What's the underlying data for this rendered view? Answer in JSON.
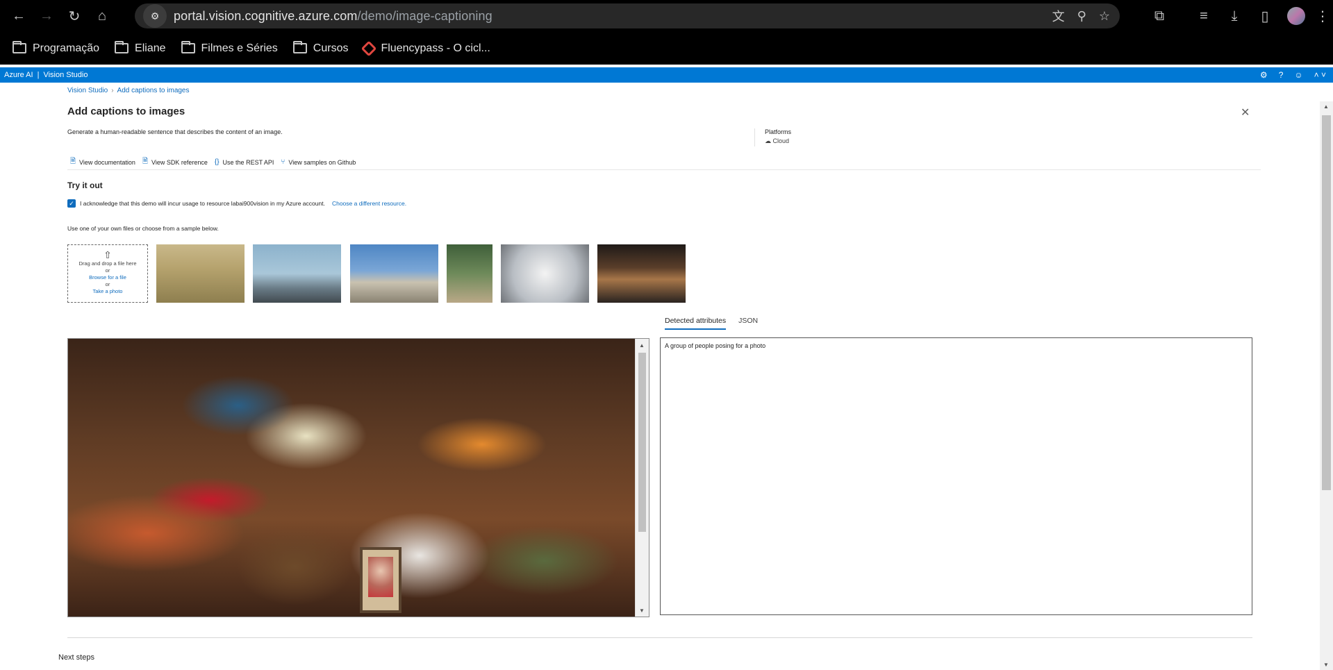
{
  "browser": {
    "url_host": "portal.vision.cognitive.azure.com",
    "url_path": "/demo/image-captioning",
    "bookmarks": [
      {
        "label": "Programação",
        "icon": "folder-icon"
      },
      {
        "label": "Eliane",
        "icon": "folder-icon"
      },
      {
        "label": "Filmes e Séries",
        "icon": "folder-icon"
      },
      {
        "label": "Cursos",
        "icon": "folder-icon"
      },
      {
        "label": "Fluencypass - O cicl...",
        "icon": "fluencypass-icon"
      }
    ]
  },
  "azure_header": {
    "brand": "Azure AI",
    "separator": "|",
    "product": "Vision Studio"
  },
  "breadcrumb": {
    "home": "Vision Studio",
    "current": "Add captions to images"
  },
  "page": {
    "title": "Add captions to images",
    "description": "Generate a human-readable sentence that describes the content of an image.",
    "platforms_label": "Platforms",
    "platforms_value": "Cloud",
    "links": [
      {
        "label": "View documentation",
        "icon": "document-icon"
      },
      {
        "label": "View SDK reference",
        "icon": "document-icon"
      },
      {
        "label": "Use the REST API",
        "icon": "braces-icon"
      },
      {
        "label": "View samples on Github",
        "icon": "branch-icon"
      }
    ],
    "try_title": "Try it out",
    "ack_text": "I acknowledge that this demo will incur usage to resource labai900vision in my Azure account.",
    "ack_checked": true,
    "choose_resource": "Choose a different resource.",
    "use_files": "Use one of your own files or choose from a sample below.",
    "dropzone": {
      "drag": "Drag and drop a file here",
      "or1": "or",
      "browse": "Browse for a file",
      "or2": "or",
      "photo": "Take a photo"
    },
    "tabs": [
      {
        "label": "Detected attributes",
        "active": true
      },
      {
        "label": "JSON",
        "active": false
      }
    ],
    "caption_result": "A group of people posing for a photo",
    "next_steps": "Next steps"
  },
  "colors": {
    "azure_blue": "#0078d4",
    "link_blue": "#0f6cbd",
    "chrome_bg": "#000000"
  }
}
